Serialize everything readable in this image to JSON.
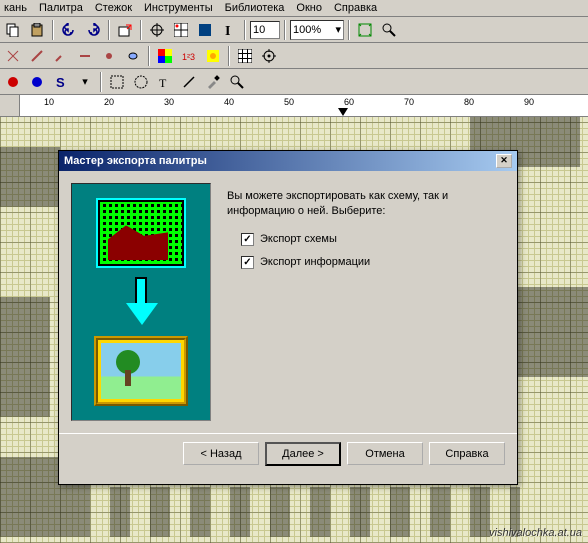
{
  "menu": {
    "items": [
      "кань",
      "Палитра",
      "Стежок",
      "Инструменты",
      "Библиотека",
      "Окно",
      "Справка"
    ]
  },
  "toolbar": {
    "grid_value": "10",
    "zoom_value": "100%"
  },
  "ruler": {
    "ticks": [
      "10",
      "20",
      "30",
      "40",
      "50",
      "60",
      "70",
      "80",
      "90"
    ],
    "marker_pos": "60"
  },
  "dialog": {
    "title": "Мастер экспорта палитры",
    "instruction": "Вы можете экспортировать как схему, так и информацию о ней.  Выберите:",
    "chk_scheme": "Экспорт схемы",
    "chk_info": "Экспорт информации",
    "btn_back": "< Назад",
    "btn_next": "Далее >",
    "btn_cancel": "Отмена",
    "btn_help": "Справка"
  },
  "watermark": "vishivalochka.at.ua"
}
